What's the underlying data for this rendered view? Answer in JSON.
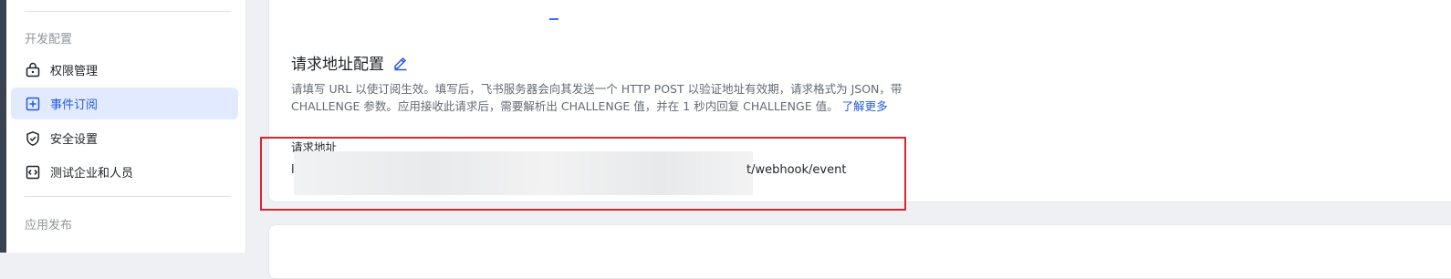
{
  "sidebar": {
    "groups": [
      {
        "title": "开发配置"
      },
      {
        "title": "应用发布"
      }
    ],
    "items": [
      {
        "label": "权限管理",
        "icon": "lock-icon",
        "active": false
      },
      {
        "label": "事件订阅",
        "icon": "event-subscription-icon",
        "active": true
      },
      {
        "label": "安全设置",
        "icon": "shield-check-icon",
        "active": false
      },
      {
        "label": "测试企业和人员",
        "icon": "code-brackets-icon",
        "active": false
      }
    ]
  },
  "main": {
    "section_title": "请求地址配置",
    "edit_icon": "pencil-edit-icon",
    "description": "请填写 URL 以使订阅生效。填写后，飞书服务器会向其发送一个 HTTP POST 以验证地址有效期，请求格式为 JSON，带 CHALLENGE 参数。应用接收此请求后，需要解析出 CHALLENGE 值，并在 1 秒内回复 CHALLENGE 值。",
    "learn_more": "了解更多",
    "field_label": "请求地址",
    "url_visible_prefix": "l",
    "url_visible_suffix": "t/webhook/event"
  },
  "colors": {
    "accent": "#245bdb",
    "active_bg": "#e1eaff",
    "highlight_border": "#e0242f",
    "muted_text": "#8f959e"
  }
}
